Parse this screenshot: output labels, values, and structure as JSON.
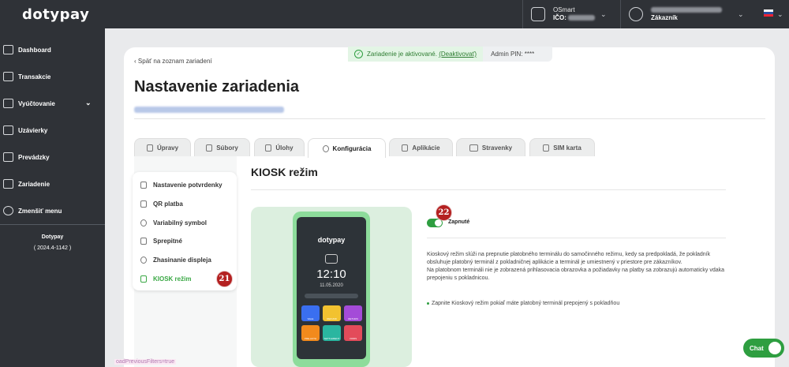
{
  "app": {
    "logo": "dotypay"
  },
  "header": {
    "company_name": "OSmart",
    "ico_label": "IČO:",
    "user_role": "Zákazník"
  },
  "sidebar": {
    "items": [
      {
        "label": "Dashboard",
        "icon": "grid-icon"
      },
      {
        "label": "Transakcie",
        "icon": "card-icon"
      },
      {
        "label": "Vyúčtovanie",
        "icon": "document-icon"
      },
      {
        "label": "Uzávierky",
        "icon": "file-icon"
      },
      {
        "label": "Prevádzky",
        "icon": "shop-icon"
      },
      {
        "label": "Zariadenie",
        "icon": "terminal-icon"
      },
      {
        "label": "Zmenšiť menu",
        "icon": "collapse-icon"
      }
    ],
    "brand": "Dotypay",
    "version": "( 2024.4-1142 )"
  },
  "banner": {
    "status": "Zariadenie je aktivované.",
    "deactivate_link": "(Deaktivovať)",
    "admin_pin": "Admin PIN: ****"
  },
  "page": {
    "back_link": "Späť na zoznam zariadení",
    "title": "Nastavenie zariadenia"
  },
  "tabs": [
    {
      "label": "Úpravy"
    },
    {
      "label": "Súbory"
    },
    {
      "label": "Úlohy"
    },
    {
      "label": "Konfigurácia"
    },
    {
      "label": "Aplikácie"
    },
    {
      "label": "Stravenky"
    },
    {
      "label": "SIM karta"
    }
  ],
  "submenu": {
    "items": [
      {
        "label": "Nastavenie potvrdenky"
      },
      {
        "label": "QR platba"
      },
      {
        "label": "Variabilný symbol"
      },
      {
        "label": "Sprepitné"
      },
      {
        "label": "Zhasinanie displeja"
      },
      {
        "label": "KIOSK režim"
      }
    ]
  },
  "badges": {
    "submenu": "21",
    "toggle": "22"
  },
  "kiosk": {
    "title": "KIOSK režim",
    "toggle_label": "Zapnuté",
    "toggle_on": true,
    "description_1": "Kioskový režim slúži na prepnutie platobného terminálu do samočinného režimu, kedy sa predpokladá, že pokladník obsluhuje platobný terminál z pokladničnej aplikácie a terminál je umiestnený v priestore pre zákazníkov.",
    "description_2": "Na platobnom termináli nie je zobrazená prihlasovacia obrazovka a požiadavky na platby sa zobrazujú automaticky vdaka prepojeniu s pokladnicou.",
    "bullet": "Zapnite Kioskový režim pokiaľ máte platobný terminál prepojený s pokladňou"
  },
  "phone": {
    "logo": "dotypay",
    "time": "12:10",
    "date": "11.05.2020",
    "tile_labels": [
      "SALE",
      "REFUND",
      "RETURN",
      "PRE-AUTH",
      "SETTLEMENT",
      "VOIDS"
    ]
  },
  "debug_text": "oadPreviousFilters=true",
  "chat": {
    "label": "Chat"
  },
  "colors": {
    "brand_green": "#2e9e40",
    "sidebar_bg": "#2f3237",
    "badge_red": "#b42020"
  }
}
